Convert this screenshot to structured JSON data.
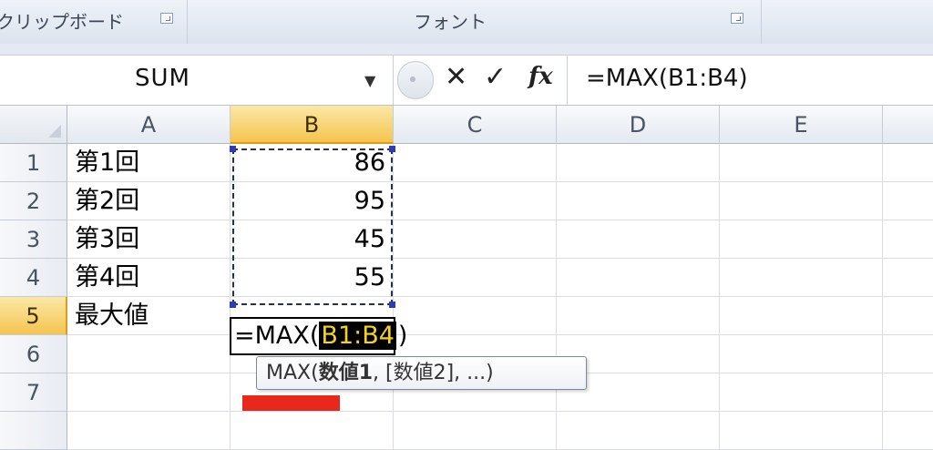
{
  "ribbon": {
    "groups": [
      {
        "label": "クリップボード"
      },
      {
        "label": "フォント"
      }
    ]
  },
  "formula_bar": {
    "name_box": "SUM",
    "cancel_icon": "cancel-x-icon",
    "enter_icon": "check-icon",
    "function_icon_label": "fx",
    "formula": "=MAX(B1:B4)"
  },
  "grid": {
    "columns": [
      "A",
      "B",
      "C",
      "D",
      "E"
    ],
    "rows": [
      "1",
      "2",
      "3",
      "4",
      "5",
      "6",
      "7"
    ],
    "cells": {
      "A1": "第1回",
      "B1": "86",
      "A2": "第2回",
      "B2": "95",
      "A3": "第3回",
      "B3": "45",
      "A4": "第4回",
      "B4": "55",
      "A5": "最大値"
    },
    "editing": {
      "prefix": "=MAX(",
      "ref": "B1:B4",
      "suffix": ")"
    }
  },
  "tooltip": {
    "fn": "MAX(",
    "arg1": "数値1",
    "rest": ", [数値2], ...)"
  },
  "colors": {
    "active_header": "#f5c44f",
    "range_ref_bg": "#000000",
    "range_ref_text": "#f2d31f",
    "annotation_mark": "#e8281c"
  }
}
